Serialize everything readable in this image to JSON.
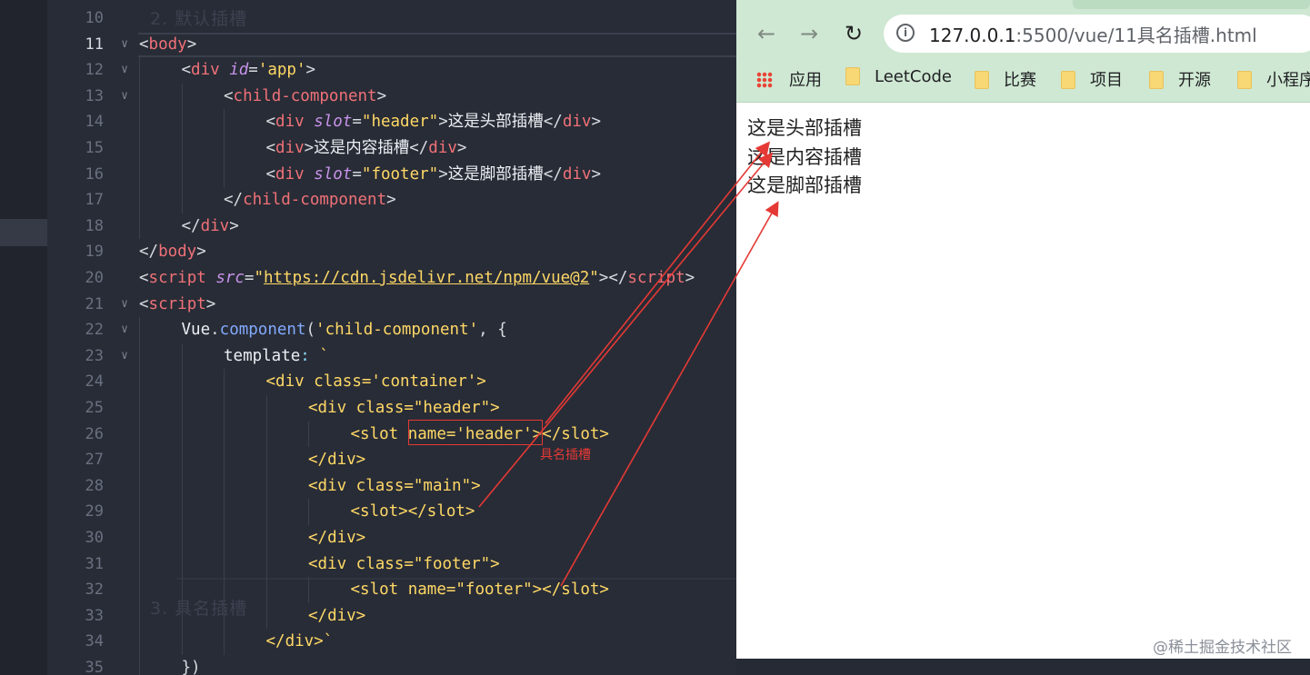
{
  "editor": {
    "ghost_heading": "2. 默认插槽",
    "ghost_heading2": "3. 具名插槽",
    "annotation_label": "具名插槽",
    "lines": [
      {
        "n": "10",
        "fold": false,
        "indent": 0,
        "html": ""
      },
      {
        "n": "11",
        "fold": true,
        "indent": 0,
        "html": "<span class='p'>&lt;</span><span class='t'>body</span><span class='p'>&gt;</span>"
      },
      {
        "n": "12",
        "fold": true,
        "indent": 1,
        "html": "<span class='p'>&lt;</span><span class='t'>div</span> <span class='a'>id</span><span class='p'>=</span><span class='s'>'app'</span><span class='p'>&gt;</span>"
      },
      {
        "n": "13",
        "fold": true,
        "indent": 2,
        "html": "<span class='p'>&lt;</span><span class='t'>child-component</span><span class='p'>&gt;</span>"
      },
      {
        "n": "14",
        "fold": false,
        "indent": 3,
        "html": "<span class='p'>&lt;</span><span class='t'>div</span> <span class='a'>slot</span><span class='p'>=</span><span class='s'>\"header\"</span><span class='p'>&gt;</span><span class='tx'>这是头部插槽</span><span class='p'>&lt;/</span><span class='t'>div</span><span class='p'>&gt;</span>"
      },
      {
        "n": "15",
        "fold": false,
        "indent": 3,
        "html": "<span class='p'>&lt;</span><span class='t'>div</span><span class='p'>&gt;</span><span class='tx'>这是内容插槽</span><span class='p'>&lt;/</span><span class='t'>div</span><span class='p'>&gt;</span>"
      },
      {
        "n": "16",
        "fold": false,
        "indent": 3,
        "html": "<span class='p'>&lt;</span><span class='t'>div</span> <span class='a'>slot</span><span class='p'>=</span><span class='s'>\"footer\"</span><span class='p'>&gt;</span><span class='tx'>这是脚部插槽</span><span class='p'>&lt;/</span><span class='t'>div</span><span class='p'>&gt;</span>"
      },
      {
        "n": "17",
        "fold": false,
        "indent": 2,
        "html": "<span class='p'>&lt;/</span><span class='t'>child-component</span><span class='p'>&gt;</span>"
      },
      {
        "n": "18",
        "fold": false,
        "indent": 1,
        "html": "<span class='p'>&lt;/</span><span class='t'>div</span><span class='p'>&gt;</span>"
      },
      {
        "n": "19",
        "fold": false,
        "indent": 0,
        "html": "<span class='p'>&lt;/</span><span class='t'>body</span><span class='p'>&gt;</span>"
      },
      {
        "n": "20",
        "fold": false,
        "indent": 0,
        "html": "<span class='p'>&lt;</span><span class='t'>script</span> <span class='a'>src</span><span class='p'>=</span><span class='s'>\"</span><span class='url'>https://cdn.jsdelivr.net/npm/vue@2</span><span class='s'>\"</span><span class='p'>&gt;&lt;/</span><span class='t'>script</span><span class='p'>&gt;</span>"
      },
      {
        "n": "21",
        "fold": true,
        "indent": 0,
        "html": "<span class='p'>&lt;</span><span class='t'>script</span><span class='p'>&gt;</span>"
      },
      {
        "n": "22",
        "fold": true,
        "indent": 1,
        "html": "<span class='tx'>Vue</span><span class='p'>.</span><span class='f'>component</span><span class='p'>(</span><span class='s'>'child-component'</span><span class='p'>, {</span>"
      },
      {
        "n": "23",
        "fold": true,
        "indent": 2,
        "html": "<span class='tx'>template</span><span class='o'>:</span> <span class='sp'>`</span>"
      },
      {
        "n": "24",
        "fold": false,
        "indent": 3,
        "html": "<span class='sp'>&lt;div class='container'&gt;</span>"
      },
      {
        "n": "25",
        "fold": false,
        "indent": 4,
        "html": "<span class='sp'>&lt;div class=\"header\"&gt;</span>"
      },
      {
        "n": "26",
        "fold": false,
        "indent": 5,
        "html": "<span class='sp'>&lt;slot name='header'&gt;&lt;/slot&gt;</span>"
      },
      {
        "n": "27",
        "fold": false,
        "indent": 4,
        "html": "<span class='sp'>&lt;/div&gt;</span>"
      },
      {
        "n": "28",
        "fold": false,
        "indent": 4,
        "html": "<span class='sp'>&lt;div class=\"main\"&gt;</span>"
      },
      {
        "n": "29",
        "fold": false,
        "indent": 5,
        "html": "<span class='sp'>&lt;slot&gt;&lt;/slot&gt;</span>"
      },
      {
        "n": "30",
        "fold": false,
        "indent": 4,
        "html": "<span class='sp'>&lt;/div&gt;</span>"
      },
      {
        "n": "31",
        "fold": false,
        "indent": 4,
        "html": "<span class='sp'>&lt;div class=\"footer\"&gt;</span>"
      },
      {
        "n": "32",
        "fold": false,
        "indent": 5,
        "html": "<span class='sp'>&lt;slot name=\"footer\"&gt;&lt;/slot&gt;</span>"
      },
      {
        "n": "33",
        "fold": false,
        "indent": 4,
        "html": "<span class='sp'>&lt;/div&gt;</span>"
      },
      {
        "n": "34",
        "fold": false,
        "indent": 3,
        "html": "<span class='sp'>&lt;/div&gt;`</span>"
      },
      {
        "n": "35",
        "fold": false,
        "indent": 1,
        "html": "<span class='p'>})</span>"
      }
    ]
  },
  "browser": {
    "url_host": "127.0.0.1",
    "url_rest": ":5500/vue/11具名插槽.html",
    "bookmarks": [
      {
        "label": "应用",
        "icon": "apps-grid-icon"
      },
      {
        "label": "LeetCode",
        "icon": "folder-icon"
      },
      {
        "label": "比赛",
        "icon": "folder-icon"
      },
      {
        "label": "项目",
        "icon": "folder-icon"
      },
      {
        "label": "开源",
        "icon": "folder-icon"
      },
      {
        "label": "小程序",
        "icon": "folder-icon"
      }
    ],
    "page_lines": [
      "这是头部插槽",
      "这是内容插槽",
      "这是脚部插槽"
    ]
  },
  "watermark": "@稀土掘金技术社区"
}
